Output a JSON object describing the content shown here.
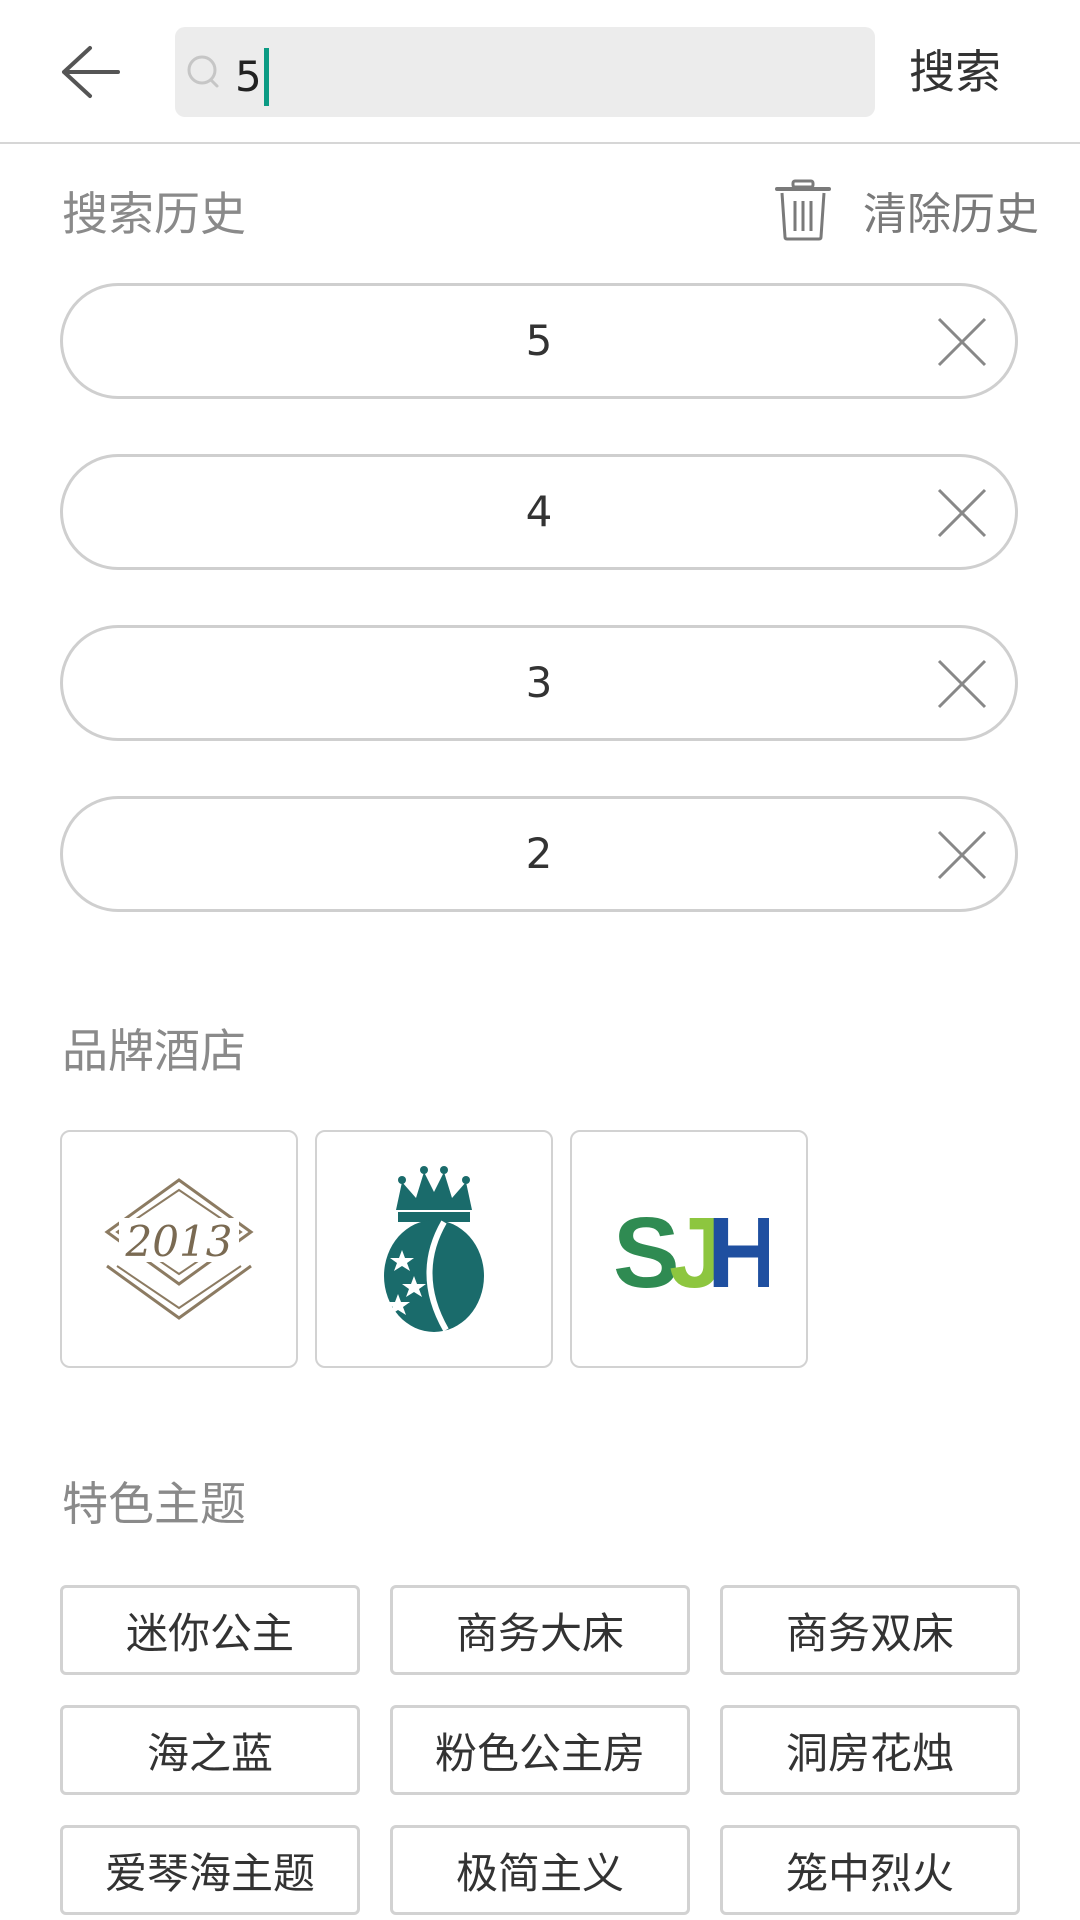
{
  "header": {
    "search_value": "5",
    "search_button_label": "搜索"
  },
  "history": {
    "title": "搜索历史",
    "clear_label": "清除历史",
    "items": [
      {
        "label": "5"
      },
      {
        "label": "4"
      },
      {
        "label": "3"
      },
      {
        "label": "2"
      }
    ]
  },
  "brands": {
    "title": "品牌酒店",
    "items": [
      {
        "logo": "2013-emblem-logo",
        "logo_text": "2013"
      },
      {
        "logo": "crown-shield-logo"
      },
      {
        "logo": "sjh-logo",
        "logo_text": "SJH"
      }
    ]
  },
  "themes": {
    "title": "特色主题",
    "items": [
      {
        "label": "迷你公主"
      },
      {
        "label": "商务大床"
      },
      {
        "label": "商务双床"
      },
      {
        "label": "海之蓝"
      },
      {
        "label": "粉色公主房"
      },
      {
        "label": "洞房花烛"
      },
      {
        "label": "爱琴海主题"
      },
      {
        "label": "极简主义"
      },
      {
        "label": "笼中烈火"
      }
    ]
  },
  "colors": {
    "accent_caret": "#0b9b84",
    "search_bg": "#ececec",
    "muted_text": "#8a8a8a"
  }
}
